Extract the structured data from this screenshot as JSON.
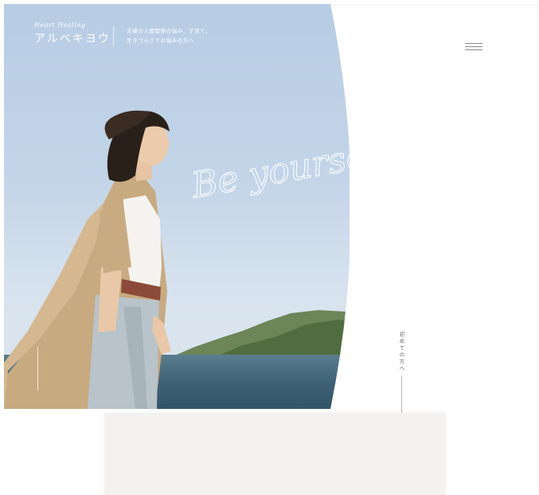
{
  "brand": {
    "english": "Heart Healing",
    "japanese": "アルベキヨウ"
  },
  "tagline": {
    "line1": "夫婦の人間関係の悩み、子育て、",
    "line2": "生きづらさでお悩みの方へ"
  },
  "hero": {
    "script_text": "Be yourself"
  },
  "side_link": {
    "label": "初めての方へ"
  },
  "colors": {
    "sky": "#c4d5e8",
    "sea": "#3e6276",
    "panel": "#f3f2f1"
  },
  "icons": {
    "menu": "hamburger-icon",
    "arrow": "arrow-down-icon"
  }
}
